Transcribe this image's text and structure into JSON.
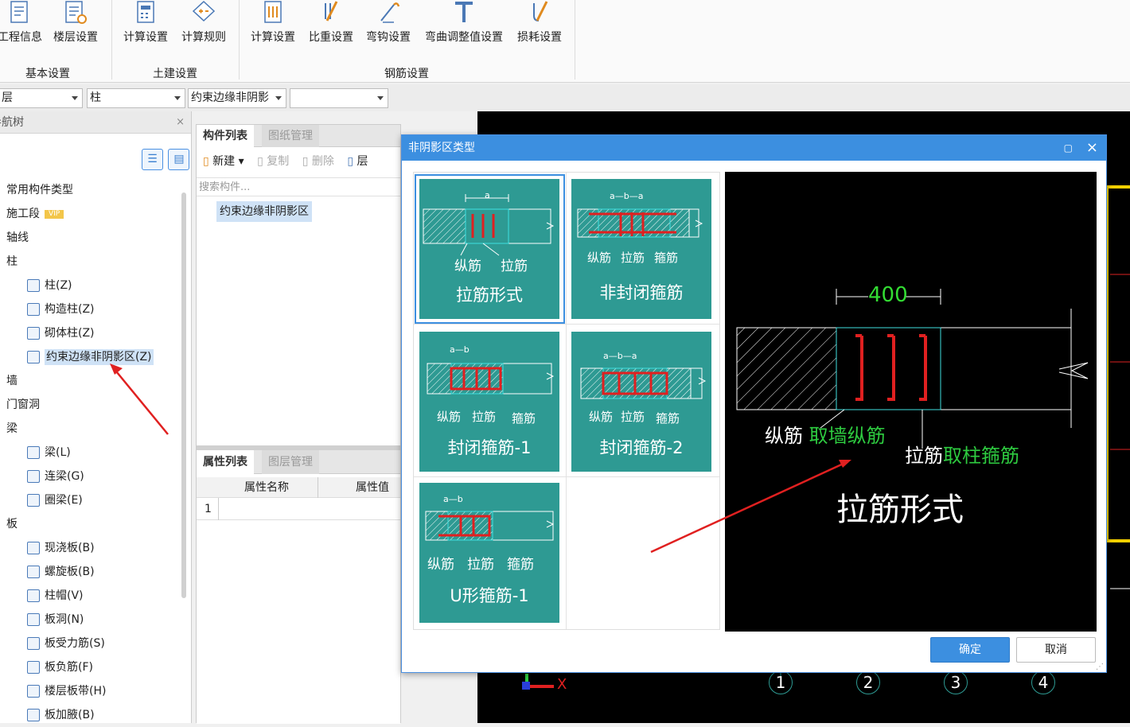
{
  "ribbon": {
    "buttons": [
      {
        "label": "工程信息",
        "icon": "project-info-icon"
      },
      {
        "label": "楼层设置",
        "icon": "floor-settings-icon"
      },
      {
        "label": "计算设置",
        "icon": "calc-settings-icon"
      },
      {
        "label": "计算规则",
        "icon": "calc-rules-icon"
      },
      {
        "label": "计算设置",
        "icon": "rebar-calc-icon"
      },
      {
        "label": "比重设置",
        "icon": "weight-icon"
      },
      {
        "label": "弯钩设置",
        "icon": "hook-icon"
      },
      {
        "label": "弯曲调整值设置",
        "icon": "bend-icon"
      },
      {
        "label": "损耗设置",
        "icon": "loss-icon"
      }
    ],
    "groups": [
      "基本设置",
      "土建设置",
      "钢筋设置"
    ]
  },
  "toolbar": {
    "combo_floor": "层",
    "combo_type": "柱",
    "combo_component": "约束边缘非阴影",
    "combo_empty": ""
  },
  "nav": {
    "title": "导航树",
    "items": [
      {
        "label": "常用构件类型",
        "level": 0
      },
      {
        "label": "施工段",
        "level": 0,
        "badge": "VIP"
      },
      {
        "label": "轴线",
        "level": 0
      },
      {
        "label": "柱",
        "level": 0
      },
      {
        "label": "柱(Z)",
        "level": 1
      },
      {
        "label": "构造柱(Z)",
        "level": 1
      },
      {
        "label": "砌体柱(Z)",
        "level": 1
      },
      {
        "label": "约束边缘非阴影区(Z)",
        "level": 1,
        "selected": true
      },
      {
        "label": "墙",
        "level": 0
      },
      {
        "label": "门窗洞",
        "level": 0
      },
      {
        "label": "梁",
        "level": 0
      },
      {
        "label": "梁(L)",
        "level": 1
      },
      {
        "label": "连梁(G)",
        "level": 1
      },
      {
        "label": "圈梁(E)",
        "level": 1
      },
      {
        "label": "板",
        "level": 0
      },
      {
        "label": "现浇板(B)",
        "level": 1
      },
      {
        "label": "螺旋板(B)",
        "level": 1
      },
      {
        "label": "柱帽(V)",
        "level": 1
      },
      {
        "label": "板洞(N)",
        "level": 1
      },
      {
        "label": "板受力筋(S)",
        "level": 1
      },
      {
        "label": "板负筋(F)",
        "level": 1
      },
      {
        "label": "楼层板带(H)",
        "level": 1
      },
      {
        "label": "板加腋(B)",
        "level": 1
      }
    ]
  },
  "components": {
    "tab_active": "构件列表",
    "tab_inactive": "图纸管理",
    "new_label": "新建",
    "copy_label": "复制",
    "delete_label": "删除",
    "floor_label": "层",
    "search_placeholder": "搜索构件...",
    "selected_item": "约束边缘非阴影区"
  },
  "properties": {
    "tab_active": "属性列表",
    "tab_inactive": "图层管理",
    "col_name": "属性名称",
    "col_value": "属性值",
    "row1": "1"
  },
  "dialog": {
    "title": "非阴影区类型",
    "options": [
      {
        "caption": "拉筋形式",
        "labels": [
          "纵筋",
          "拉筋"
        ],
        "dims": "a",
        "selected": true
      },
      {
        "caption": "非封闭箍筋",
        "labels": [
          "纵筋",
          "拉筋",
          "箍筋"
        ],
        "dims": "a—b—a"
      },
      {
        "caption": "封闭箍筋-1",
        "labels": [
          "纵筋",
          "拉筋",
          "箍筋"
        ],
        "dims": "a—b"
      },
      {
        "caption": "封闭箍筋-2",
        "labels": [
          "纵筋",
          "拉筋",
          "箍筋"
        ],
        "dims": "a—b—a"
      },
      {
        "caption": "U形箍筋-1",
        "labels": [
          "纵筋",
          "拉筋",
          "箍筋"
        ],
        "dims": "a—b"
      }
    ],
    "preview": {
      "dim": "400",
      "rebar_label": "纵筋",
      "rebar_source": "取墙纵筋",
      "tie_label": "拉筋",
      "tie_source": "取柱箍筋",
      "caption": "拉筋形式"
    },
    "ok": "确定",
    "cancel": "取消"
  },
  "canvas": {
    "axis_numbers": [
      "1",
      "2",
      "3",
      "4"
    ],
    "axis_x": "X"
  },
  "colors": {
    "dialog_title": "#3c8fe0",
    "card_bg": "#2e9a93",
    "rebar_red": "#e02020",
    "label_green": "#2ecc40",
    "dim_green": "#33dd33",
    "ok_button": "#3c8fe0"
  }
}
